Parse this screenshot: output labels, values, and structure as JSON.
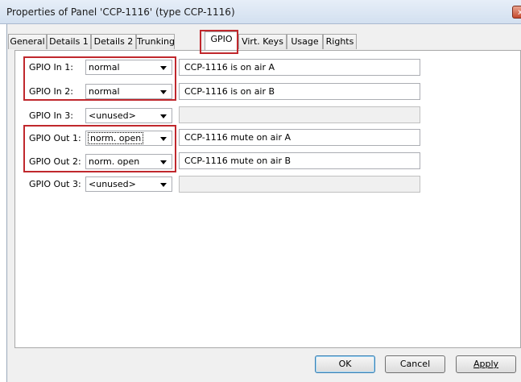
{
  "window": {
    "title": "Properties of Panel 'CCP-1116' (type CCP-1116)",
    "close_label": "x"
  },
  "tabs": [
    {
      "label": "General"
    },
    {
      "label": "Details 1"
    },
    {
      "label": "Details 2"
    },
    {
      "label": "Trunking"
    },
    {
      "label": "GPIO",
      "active": true
    },
    {
      "label": "Virt. Keys"
    },
    {
      "label": "Usage"
    },
    {
      "label": "Rights"
    }
  ],
  "gpio_rows": [
    {
      "label": "GPIO In 1:",
      "mode": "normal",
      "text": "CCP-1116 is on air A",
      "enabled": true
    },
    {
      "label": "GPIO In 2:",
      "mode": "normal",
      "text": "CCP-1116 is on air B",
      "enabled": true
    },
    {
      "label": "GPIO In 3:",
      "mode": "<unused>",
      "text": "",
      "enabled": false
    },
    {
      "label": "GPIO Out 1:",
      "mode": "norm. open",
      "text": "CCP-1116 mute on air A",
      "enabled": true
    },
    {
      "label": "GPIO Out 2:",
      "mode": "norm. open",
      "text": "CCP-1116 mute on air B",
      "enabled": true
    },
    {
      "label": "GPIO Out 3:",
      "mode": "<unused>",
      "text": "",
      "enabled": false
    }
  ],
  "buttons": {
    "ok": "OK",
    "cancel": "Cancel",
    "apply": "Apply"
  },
  "colors": {
    "highlight": "#c0282d",
    "tab_background": "#f0f0f0"
  }
}
